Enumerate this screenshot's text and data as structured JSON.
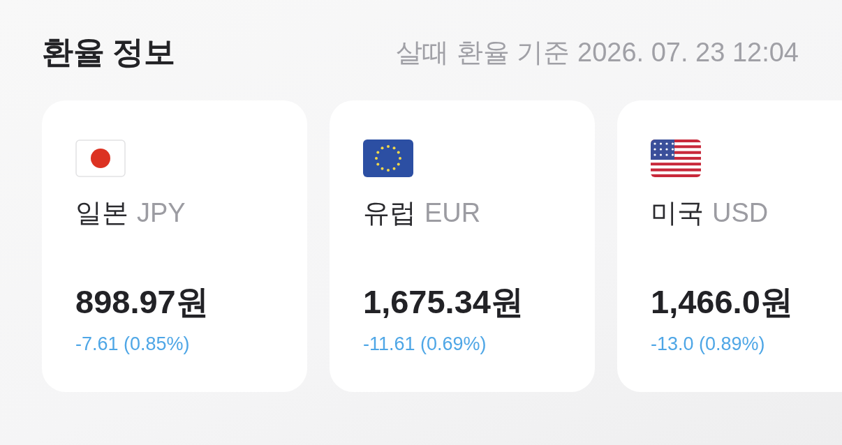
{
  "header": {
    "title": "환율 정보",
    "basis": "살때 환율 기준 2026. 07. 23 12:04"
  },
  "cards": [
    {
      "name": "일본",
      "code": "JPY",
      "price": "898.97원",
      "change": "-7.61 (0.85%)"
    },
    {
      "name": "유럽",
      "code": "EUR",
      "price": "1,675.34원",
      "change": "-11.61 (0.69%)"
    },
    {
      "name": "미국",
      "code": "USD",
      "price": "1,466.0원",
      "change": "-13.0 (0.89%)"
    }
  ]
}
